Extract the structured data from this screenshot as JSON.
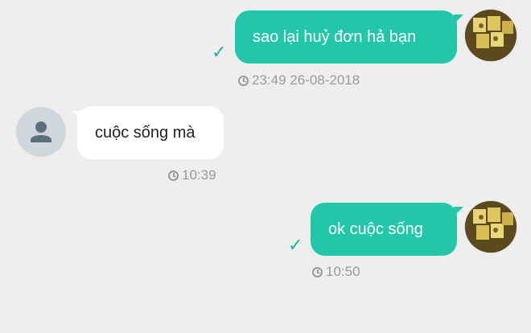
{
  "colors": {
    "background": "#eeeeee",
    "outgoing_bubble": "#22c6a8",
    "incoming_bubble": "#ffffff",
    "checkmark": "#18b79d"
  },
  "messages": [
    {
      "direction": "outgoing",
      "text": "sao lại huỷ đơn hả bạn",
      "time": "23:49 26-08-2018",
      "status": "sent-check-icon"
    },
    {
      "direction": "incoming",
      "text": "cuộc sống mà",
      "time": "10:39"
    },
    {
      "direction": "outgoing",
      "text": "ok cuộc sống",
      "time": "10:50",
      "status": "sent-check-icon"
    }
  ]
}
